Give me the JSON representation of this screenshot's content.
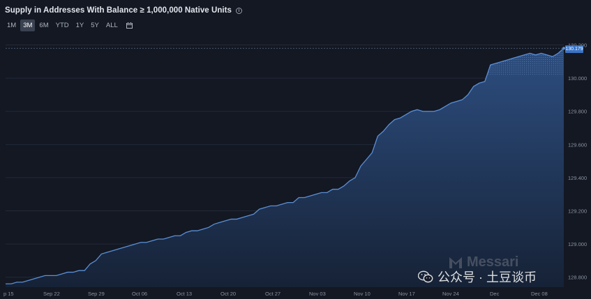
{
  "header": {
    "title": "Supply in Addresses With Balance ≥ 1,000,000 Native Units",
    "info_icon": "info-icon"
  },
  "range_buttons": [
    {
      "label": "1M",
      "active": false
    },
    {
      "label": "3M",
      "active": true
    },
    {
      "label": "6M",
      "active": false
    },
    {
      "label": "YTD",
      "active": false
    },
    {
      "label": "1Y",
      "active": false
    },
    {
      "label": "5Y",
      "active": false
    },
    {
      "label": "ALL",
      "active": false
    }
  ],
  "calendar_icon": "calendar-icon",
  "last_value_label": "130.179",
  "watermark": {
    "brand": "Messari",
    "wechat": "公众号 · 土豆谈币",
    "wechat_icon": "wechat-icon"
  },
  "colors": {
    "background": "#131823",
    "line": "#5b8fd6",
    "fill_top": "#2d4e80",
    "fill_bottom": "#162236",
    "badge": "#3a73c4"
  },
  "chart_data": {
    "type": "area",
    "title": "Supply in Addresses With Balance ≥ 1,000,000 Native Units",
    "xlabel": "",
    "ylabel": "",
    "x_tick_labels": [
      "p 15",
      "Sep 22",
      "Sep 29",
      "Oct 06",
      "Oct 13",
      "Oct 20",
      "Oct 27",
      "Nov 03",
      "Nov 10",
      "Nov 17",
      "Nov 24",
      "Dec",
      "Dec 08"
    ],
    "y_tick_labels": [
      "128.800",
      "129.000",
      "129.200",
      "129.400",
      "129.600",
      "129.800",
      "130.000",
      "130.200"
    ],
    "ylim": [
      128.74,
      130.24
    ],
    "grid": true,
    "series": [
      {
        "values": [
          128.76,
          128.76,
          128.77,
          128.77,
          128.78,
          128.79,
          128.8,
          128.81,
          128.81,
          128.81,
          128.82,
          128.83,
          128.83,
          128.84,
          128.84,
          128.88,
          128.9,
          128.94,
          128.95,
          128.96,
          128.97,
          128.98,
          128.99,
          129.0,
          129.01,
          129.01,
          129.02,
          129.03,
          129.03,
          129.04,
          129.05,
          129.05,
          129.07,
          129.08,
          129.08,
          129.09,
          129.1,
          129.12,
          129.13,
          129.14,
          129.15,
          129.15,
          129.16,
          129.17,
          129.18,
          129.21,
          129.22,
          129.23,
          129.23,
          129.24,
          129.25,
          129.25,
          129.28,
          129.28,
          129.29,
          129.3,
          129.31,
          129.31,
          129.33,
          129.33,
          129.35,
          129.38,
          129.4,
          129.47,
          129.51,
          129.55,
          129.65,
          129.68,
          129.72,
          129.75,
          129.76,
          129.78,
          129.8,
          129.81,
          129.8,
          129.8,
          129.8,
          129.81,
          129.83,
          129.85,
          129.86,
          129.87,
          129.9,
          129.95,
          129.97,
          129.98,
          130.08,
          130.09,
          130.1,
          130.11,
          130.12,
          130.13,
          130.14,
          130.15,
          130.14,
          130.15,
          130.14,
          130.13,
          130.15,
          130.18
        ]
      }
    ]
  }
}
